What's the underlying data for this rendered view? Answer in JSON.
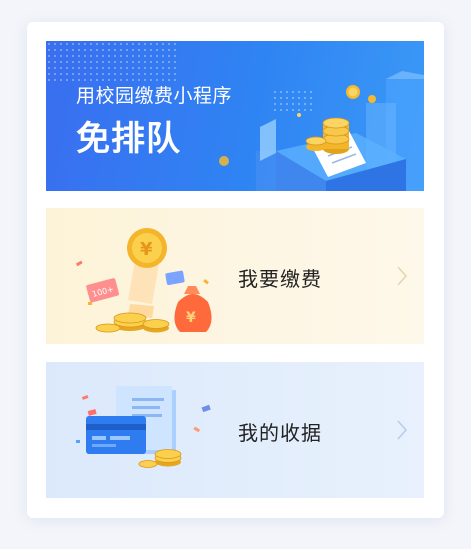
{
  "banner": {
    "subtitle": "用校园缴费小程序",
    "title": "免排队",
    "colors": {
      "start": "#3a6ef0",
      "end": "#3b99f6"
    }
  },
  "menu": {
    "pay": {
      "label": "我要缴费",
      "illustration": "coin-hand-money-bag-illustration",
      "coin_symbol": "¥",
      "ticket_text": "100+"
    },
    "receipt": {
      "label": "我的收据",
      "illustration": "receipt-card-coins-illustration"
    }
  },
  "icons": {
    "chevron": "chevron-right-icon"
  }
}
